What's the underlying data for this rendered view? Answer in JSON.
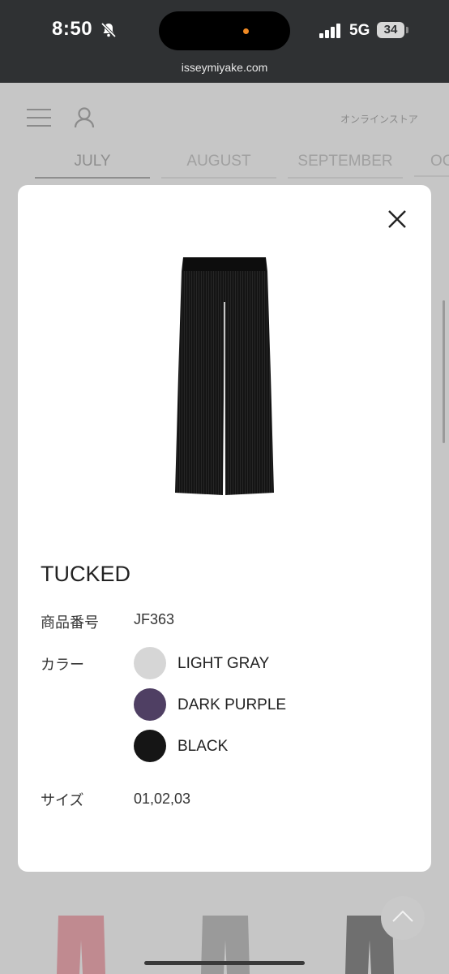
{
  "status_bar": {
    "time": "8:50",
    "network": "5G",
    "battery": "34",
    "url": "isseymiyake.com"
  },
  "header": {
    "store_link": "オンラインストア"
  },
  "month_tabs": [
    {
      "label": "JULY",
      "active": true
    },
    {
      "label": "AUGUST",
      "active": false
    },
    {
      "label": "SEPTEMBER",
      "active": false
    },
    {
      "label": "OC",
      "active": false
    }
  ],
  "product": {
    "name": "TUCKED",
    "number_label": "商品番号",
    "number_value": "JF363",
    "color_label": "カラー",
    "colors": [
      {
        "name": "LIGHT GRAY",
        "hex": "#d6d6d6"
      },
      {
        "name": "DARK PURPLE",
        "hex": "#4f3f63"
      },
      {
        "name": "BLACK",
        "hex": "#151515"
      }
    ],
    "size_label": "サイズ",
    "size_value": "01,02,03"
  },
  "icons": {
    "menu": "hamburger-icon",
    "account": "user-icon",
    "close": "close-icon",
    "scroll_top": "chevron-up-icon"
  }
}
